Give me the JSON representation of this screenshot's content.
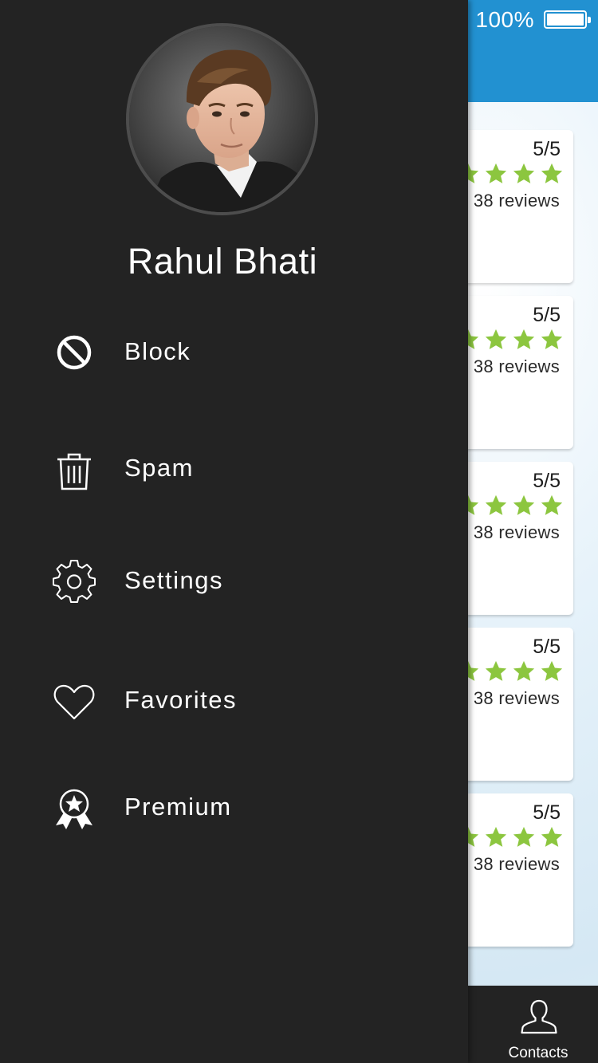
{
  "status_bar": {
    "battery_text": "100%"
  },
  "drawer": {
    "profile_name": "Rahul Bhati",
    "menu": [
      {
        "label": "Block",
        "icon": "block-icon"
      },
      {
        "label": "Spam",
        "icon": "trash-icon"
      },
      {
        "label": "Settings",
        "icon": "gear-icon"
      },
      {
        "label": "Favorites",
        "icon": "heart-icon"
      },
      {
        "label": "Premium",
        "icon": "award-icon"
      }
    ]
  },
  "cards": [
    {
      "score": "5/5",
      "reviews": "38 reviews"
    },
    {
      "score": "5/5",
      "reviews": "38 reviews"
    },
    {
      "score": "5/5",
      "reviews": "38 reviews"
    },
    {
      "score": "5/5",
      "reviews": "38 reviews"
    },
    {
      "score": "5/5",
      "reviews": "38 reviews"
    }
  ],
  "bottom_nav": {
    "contacts_label": "Contacts"
  },
  "colors": {
    "header": "#2291d1",
    "drawer": "#232323",
    "star": "#8cc63f",
    "text_light": "#ffffff"
  }
}
